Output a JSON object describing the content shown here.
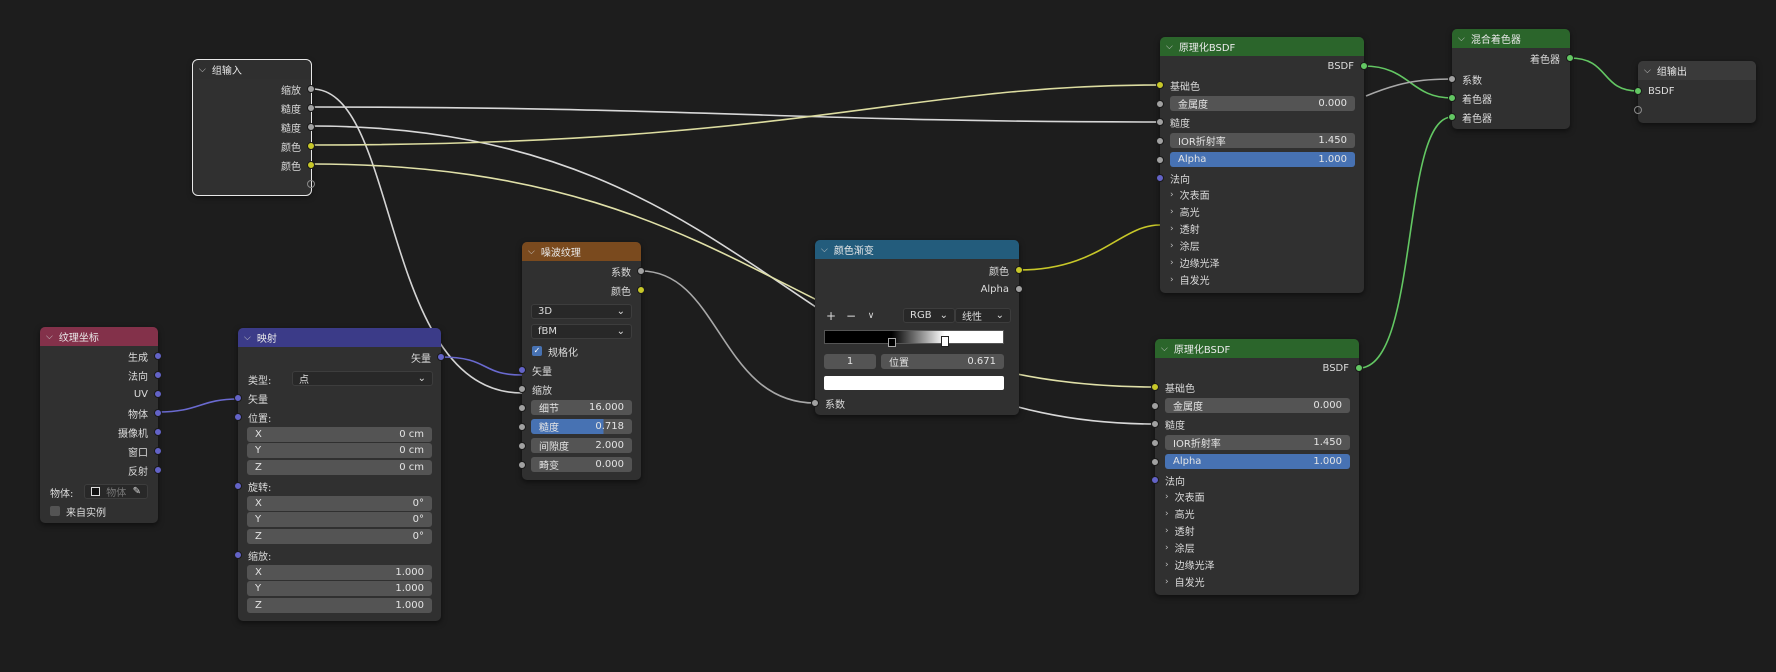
{
  "colors": {
    "background": "#1d1d1d",
    "node_body": "#303030",
    "header_input": "#2f2f2f",
    "header_texcoord": "#83314a",
    "header_vector": "#3b3b88",
    "header_texture": "#7a4a1e",
    "header_converter": "#235c7c",
    "header_shader": "#2b652b",
    "header_output": "#3a3a3a",
    "socket_gray": "#a1a1a1",
    "socket_yellow": "#c7c729",
    "socket_purple": "#6363c7",
    "socket_green": "#63c763",
    "field_blue": "#4772b3"
  },
  "group_input": {
    "title": "组输入",
    "outputs": [
      "缩放",
      "糙度",
      "糙度",
      "颜色",
      "颜色"
    ]
  },
  "tex_coord": {
    "title": "纹理坐标",
    "outputs": [
      "生成",
      "法向",
      "UV",
      "物体",
      "摄像机",
      "窗口",
      "反射"
    ],
    "object_label": "物体:",
    "object_placeholder": "物体",
    "from_instancer": "来自实例"
  },
  "mapping": {
    "title": "映射",
    "output": "矢量",
    "type_label": "类型:",
    "type_value": "点",
    "vector_label": "矢量",
    "location_label": "位置:",
    "location": [
      {
        "axis": "X",
        "value": "0 cm"
      },
      {
        "axis": "Y",
        "value": "0 cm"
      },
      {
        "axis": "Z",
        "value": "0 cm"
      }
    ],
    "rotation_label": "旋转:",
    "rotation": [
      {
        "axis": "X",
        "value": "0°"
      },
      {
        "axis": "Y",
        "value": "0°"
      },
      {
        "axis": "Z",
        "value": "0°"
      }
    ],
    "scale_label": "缩放:",
    "scale": [
      {
        "axis": "X",
        "value": "1.000"
      },
      {
        "axis": "Y",
        "value": "1.000"
      },
      {
        "axis": "Z",
        "value": "1.000"
      }
    ]
  },
  "noise": {
    "title": "噪波纹理",
    "outputs": [
      "系数",
      "颜色"
    ],
    "dimensions": "3D",
    "type": "fBM",
    "normalize_label": "规格化",
    "normalize_checked": true,
    "inputs": [
      "矢量",
      "缩放"
    ],
    "detail_label": "细节",
    "detail_value": "16.000",
    "roughness_label": "糙度",
    "roughness_value": "0.718",
    "roughness_fraction": 0.718,
    "lacunarity_label": "间隙度",
    "lacunarity_value": "2.000",
    "distortion_label": "畸变",
    "distortion_value": "0.000"
  },
  "color_ramp": {
    "title": "颜色渐变",
    "outputs": [
      "颜色",
      "Alpha"
    ],
    "add_btn": "+",
    "remove_btn": "−",
    "menu_btn": "∨",
    "color_mode": "RGB",
    "interpolation": "线性",
    "stop_index": "1",
    "position_label": "位置",
    "position_value": "0.671",
    "stop_positions": [
      0.375,
      0.671
    ],
    "input": "系数"
  },
  "bsdf1": {
    "title": "原理化BSDF",
    "output": "BSDF",
    "base_color": "基础色",
    "metallic_label": "金属度",
    "metallic_value": "0.000",
    "roughness": "糙度",
    "ior_label": "IOR折射率",
    "ior_value": "1.450",
    "alpha_label": "Alpha",
    "alpha_value": "1.000",
    "normal": "法向",
    "panels": [
      "次表面",
      "高光",
      "透射",
      "涂层",
      "边缘光泽",
      "自发光"
    ]
  },
  "bsdf2": {
    "title": "原理化BSDF",
    "output": "BSDF",
    "base_color": "基础色",
    "metallic_label": "金属度",
    "metallic_value": "0.000",
    "roughness": "糙度",
    "ior_label": "IOR折射率",
    "ior_value": "1.450",
    "alpha_label": "Alpha",
    "alpha_value": "1.000",
    "normal": "法向",
    "panels": [
      "次表面",
      "高光",
      "透射",
      "涂层",
      "边缘光泽",
      "自发光"
    ]
  },
  "mix_shader": {
    "title": "混合着色器",
    "output": "着色器",
    "inputs": [
      "系数",
      "着色器",
      "着色器"
    ]
  },
  "group_output": {
    "title": "组输出",
    "input": "BSDF"
  }
}
